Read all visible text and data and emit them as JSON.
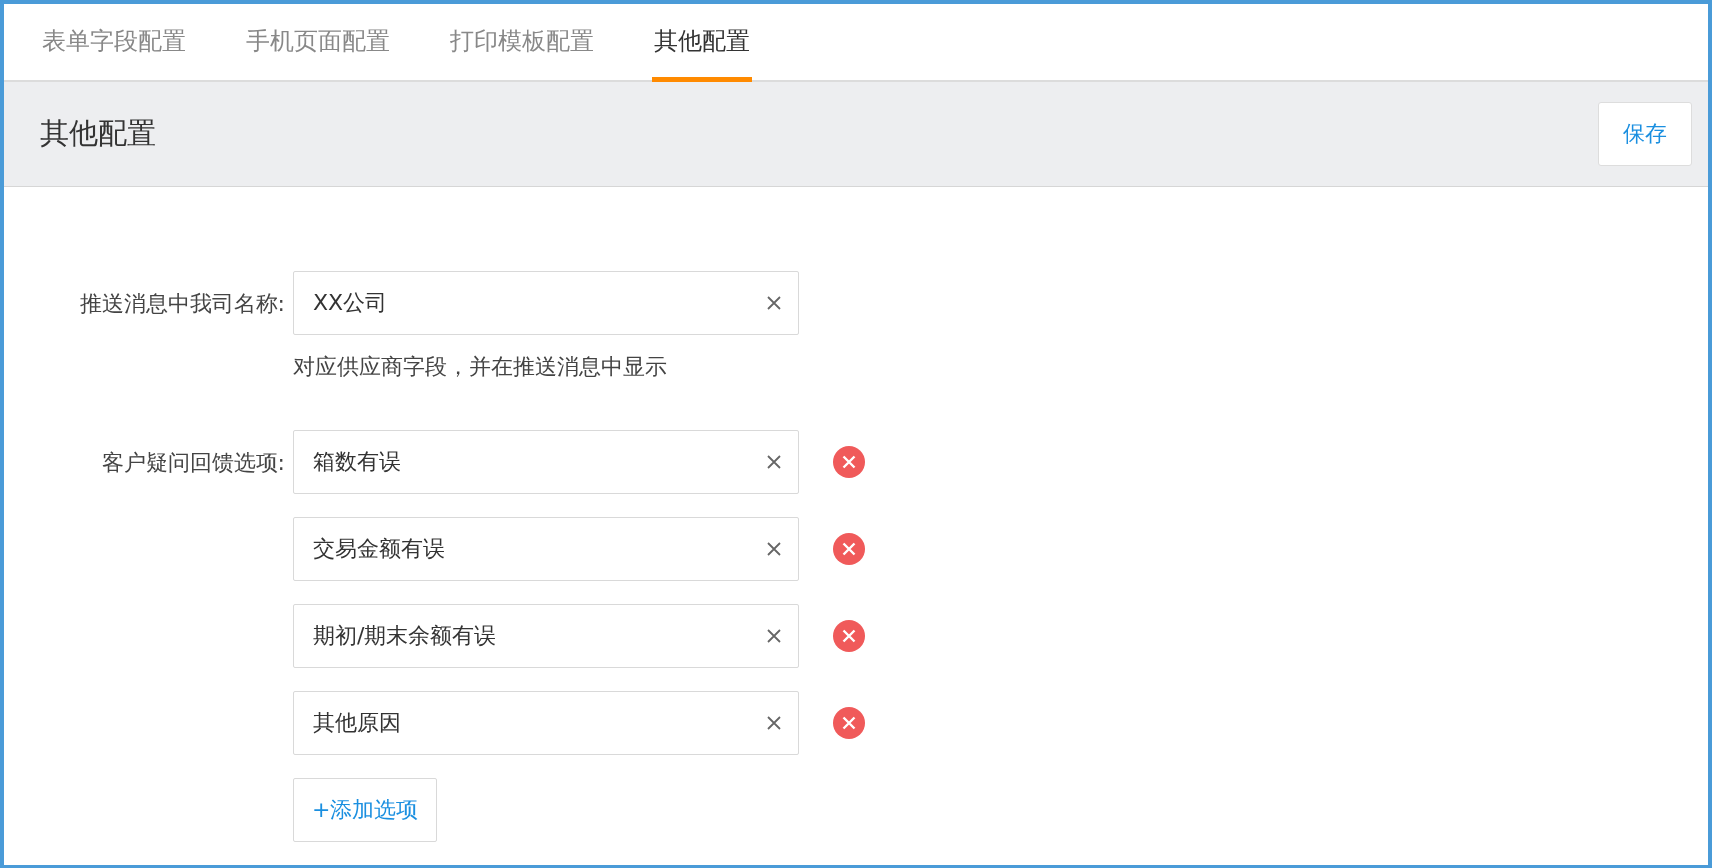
{
  "tabs": [
    {
      "label": "表单字段配置",
      "selected": false
    },
    {
      "label": "手机页面配置",
      "selected": false
    },
    {
      "label": "打印模板配置",
      "selected": false
    },
    {
      "label": "其他配置",
      "selected": true
    }
  ],
  "header": {
    "title": "其他配置",
    "save_button": "保存"
  },
  "company_name": {
    "label": "推送消息中我司名称:",
    "value": "XX公司",
    "hint": "对应供应商字段，并在推送消息中显示"
  },
  "feedback_options": {
    "label": "客户疑问回馈选项:",
    "options": [
      {
        "value": "箱数有误"
      },
      {
        "value": "交易金额有误"
      },
      {
        "value": "期初/期末余额有误"
      },
      {
        "value": "其他原因"
      }
    ],
    "add_button": "+添加选项"
  }
}
